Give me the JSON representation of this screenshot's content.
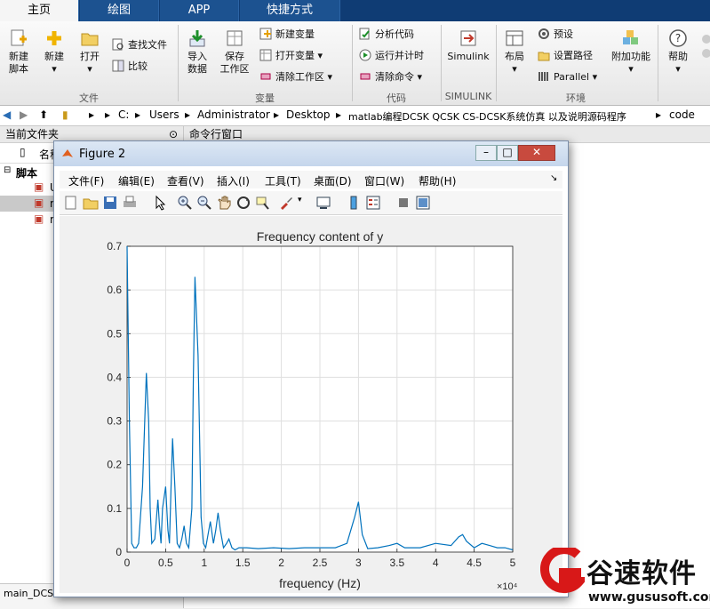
{
  "tabs": [
    {
      "label": "主页",
      "active": true
    },
    {
      "label": "绘图",
      "active": false
    },
    {
      "label": "APP",
      "active": false
    },
    {
      "label": "快捷方式",
      "active": false
    }
  ],
  "ribbon": {
    "new_script": "新建\n脚本",
    "new": "新建",
    "open": "打开",
    "find_files": "查找文件",
    "compare": "比较",
    "import_data": "导入\n数据",
    "save_workspace": "保存\n工作区",
    "new_variable": "新建变量",
    "open_variable": "打开变量",
    "clear_workspace": "清除工作区",
    "analyze_code": "分析代码",
    "run_and_time": "运行并计时",
    "clear_commands": "清除命令",
    "simulink": "Simulink",
    "layout": "布局",
    "preferences": "预设",
    "set_path": "设置路径",
    "parallel": "Parallel",
    "addons": "附加功能",
    "help": "帮助",
    "groups": {
      "file": "文件",
      "variable": "变量",
      "code": "代码",
      "simulink": "SIMULINK",
      "environment": "环境"
    }
  },
  "address": {
    "crumbs": [
      "C:",
      "Users",
      "Administrator",
      "Desktop",
      "matlab编程DCSK QCSK CS-DCSK系统仿真 以及说明源码程序",
      "code"
    ]
  },
  "left_panel": {
    "title": "当前文件夹",
    "column": "名称",
    "folder": "脚本",
    "files": [
      "U",
      "m",
      "m"
    ],
    "bottom_file": "main_DCS"
  },
  "command_window": {
    "title": "命令行窗口"
  },
  "figure": {
    "title": "Figure 2",
    "menu": [
      "文件(F)",
      "编辑(E)",
      "查看(V)",
      "插入(I)",
      "工具(T)",
      "桌面(D)",
      "窗口(W)",
      "帮助(H)"
    ]
  },
  "watermark": {
    "brand": "谷速软件",
    "url": "www.gususoft.com"
  },
  "chart_data": {
    "type": "line",
    "title": "Frequency content of y",
    "xlabel": "frequency (Hz)",
    "ylabel": "",
    "x_exponent_label": "×10⁴",
    "xlim": [
      0,
      5
    ],
    "ylim": [
      0,
      0.7
    ],
    "xticks": [
      0,
      0.5,
      1,
      1.5,
      2,
      2.5,
      3,
      3.5,
      4,
      4.5,
      5
    ],
    "yticks": [
      0,
      0.1,
      0.2,
      0.3,
      0.4,
      0.5,
      0.6,
      0.7
    ],
    "grid": true,
    "line_color": "#0072bd",
    "x": [
      0,
      0.03,
      0.06,
      0.09,
      0.12,
      0.15,
      0.2,
      0.25,
      0.28,
      0.3,
      0.32,
      0.36,
      0.4,
      0.42,
      0.44,
      0.46,
      0.5,
      0.53,
      0.55,
      0.57,
      0.59,
      0.62,
      0.65,
      0.68,
      0.71,
      0.74,
      0.77,
      0.8,
      0.84,
      0.86,
      0.88,
      0.92,
      0.96,
      0.99,
      1.02,
      1.05,
      1.08,
      1.12,
      1.15,
      1.18,
      1.21,
      1.25,
      1.29,
      1.32,
      1.36,
      1.4,
      1.45,
      1.55,
      1.7,
      1.9,
      2.1,
      2.3,
      2.5,
      2.7,
      2.85,
      2.95,
      3.0,
      3.05,
      3.12,
      3.25,
      3.4,
      3.5,
      3.6,
      3.8,
      4.0,
      4.2,
      4.3,
      4.35,
      4.4,
      4.5,
      4.6,
      4.7,
      4.8,
      4.9,
      5.0
    ],
    "y": [
      0.7,
      0.3,
      0.02,
      0.01,
      0.01,
      0.02,
      0.15,
      0.41,
      0.3,
      0.1,
      0.02,
      0.03,
      0.12,
      0.06,
      0.02,
      0.1,
      0.15,
      0.05,
      0.02,
      0.15,
      0.26,
      0.15,
      0.02,
      0.01,
      0.03,
      0.06,
      0.02,
      0.01,
      0.1,
      0.4,
      0.63,
      0.45,
      0.08,
      0.02,
      0.01,
      0.04,
      0.07,
      0.02,
      0.05,
      0.09,
      0.05,
      0.01,
      0.02,
      0.03,
      0.01,
      0.005,
      0.01,
      0.01,
      0.008,
      0.01,
      0.008,
      0.01,
      0.01,
      0.01,
      0.02,
      0.08,
      0.115,
      0.04,
      0.008,
      0.01,
      0.015,
      0.02,
      0.01,
      0.01,
      0.02,
      0.015,
      0.035,
      0.04,
      0.025,
      0.01,
      0.02,
      0.015,
      0.01,
      0.01,
      0.005
    ]
  }
}
